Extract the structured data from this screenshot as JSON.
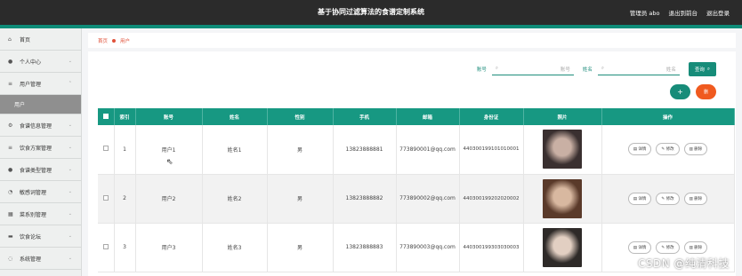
{
  "header": {
    "title": "基于协同过滤算法的食谱定制系统",
    "user": "管理员 abo",
    "backend_link": "退出到前台",
    "logout_link": "退出登录"
  },
  "sidebar": {
    "items": [
      {
        "label": "首页",
        "icon": "home-icon",
        "glyph": "⌂"
      },
      {
        "label": "个人中心",
        "icon": "person-icon",
        "glyph": "●"
      },
      {
        "label": "用户管理",
        "icon": "list-icon",
        "glyph": "≡"
      },
      {
        "label": "用户",
        "sub": true
      },
      {
        "label": "食谱信息管理",
        "icon": "gear-icon",
        "glyph": "⚙"
      },
      {
        "label": "饮食方案管理",
        "icon": "list-icon",
        "glyph": "≡"
      },
      {
        "label": "食谱类型管理",
        "icon": "pin-icon",
        "glyph": "●"
      },
      {
        "label": "敏感词管理",
        "icon": "clock-icon",
        "glyph": "◔"
      },
      {
        "label": "菜系别管理",
        "icon": "grid-icon",
        "glyph": "▦"
      },
      {
        "label": "饮食论坛",
        "icon": "chat-icon",
        "glyph": "▬"
      },
      {
        "label": "系统管理",
        "icon": "settings-icon",
        "glyph": "◌"
      }
    ]
  },
  "breadcrumb": {
    "home": "首页",
    "current": "用户"
  },
  "search": {
    "account_label": "账号",
    "account_placeholder": "账号",
    "name_label": "姓名",
    "name_placeholder": "姓名",
    "button_label": "查询"
  },
  "toolbar": {
    "add_label": "+",
    "delete_label": "删"
  },
  "table": {
    "headers": [
      "索引",
      "账号",
      "姓名",
      "性别",
      "手机",
      "邮箱",
      "身份证",
      "照片",
      "操作"
    ],
    "rows": [
      {
        "index": "1",
        "account": "用户1",
        "name": "姓名1",
        "gender": "男",
        "phone": "13823888881",
        "email": "773890001@qq.com",
        "idcard": "440300199101010001",
        "photo_colors": [
          "#3a3030",
          "#c9b0a4"
        ]
      },
      {
        "index": "2",
        "account": "用户2",
        "name": "姓名2",
        "gender": "男",
        "phone": "13823888882",
        "email": "773890002@qq.com",
        "idcard": "440300199202020002",
        "photo_colors": [
          "#5a3a2a",
          "#d8b8a0"
        ]
      },
      {
        "index": "3",
        "account": "用户3",
        "name": "姓名3",
        "gender": "男",
        "phone": "13823888883",
        "email": "773890003@qq.com",
        "idcard": "440300199303030003",
        "photo_colors": [
          "#2e2a28",
          "#e2cfc2"
        ]
      }
    ],
    "op_labels": {
      "detail": "详情",
      "edit": "修改",
      "delete": "删除"
    }
  },
  "watermark": "CSDN @纯清科技",
  "colors": {
    "accent": "#179882",
    "danger": "#f05a1f",
    "topbar": "#2b2b2b"
  }
}
